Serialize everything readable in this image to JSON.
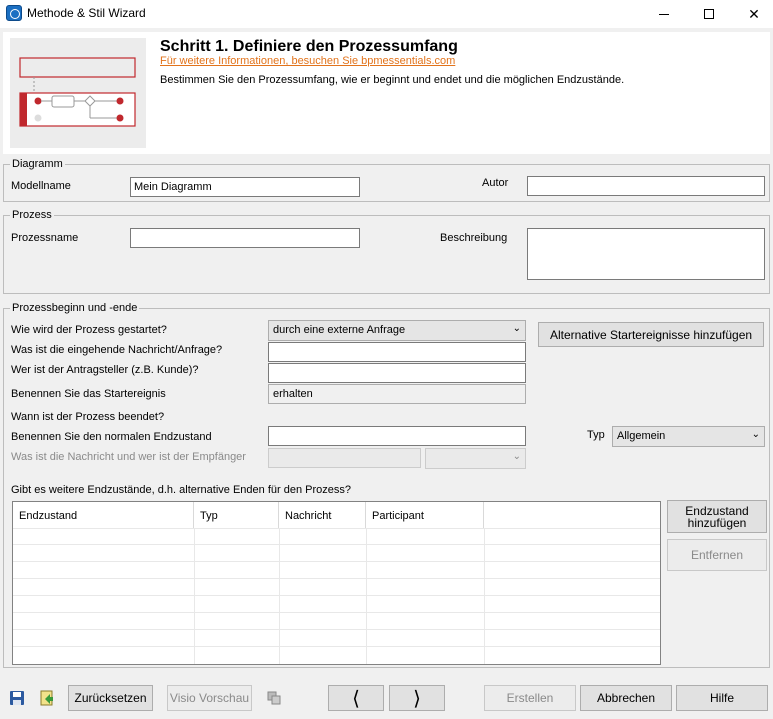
{
  "window": {
    "title": "Methode & Stil Wizard"
  },
  "header": {
    "step_title": "Schritt 1. Definiere den Prozessumfang",
    "link": "Für weitere Informationen, besuchen Sie bpmessentials.com",
    "description": "Bestimmen Sie den Prozessumfang, wie er beginnt und endet und die möglichen Endzustände."
  },
  "diagram": {
    "legend": "Diagramm",
    "model_name_label": "Modellname",
    "model_name_value": "Mein Diagramm",
    "author_label": "Autor",
    "author_value": ""
  },
  "process": {
    "legend": "Prozess",
    "name_label": "Prozessname",
    "name_value": "",
    "description_label": "Beschreibung",
    "description_value": ""
  },
  "start_end": {
    "legend": "Prozessbeginn und -ende",
    "how_started_label": "Wie wird der Prozess gestartet?",
    "how_started_value": "durch eine externe Anfrage",
    "alt_start_button": "Alternative Startereignisse hinzufügen",
    "incoming_message_label": "Was ist die eingehende Nachricht/Anfrage?",
    "incoming_message_value": "",
    "requester_label": "Wer ist der Antragsteller (z.B. Kunde)?",
    "requester_value": "",
    "start_event_label": "Benennen Sie das Startereignis",
    "start_event_value": "erhalten",
    "when_ended_label": "Wann ist der Prozess beendet?",
    "normal_end_label": "Benennen Sie den normalen Endzustand",
    "normal_end_value": "",
    "type_label": "Typ",
    "type_value": "Allgemein",
    "message_receiver_label": "Was ist die Nachricht und wer ist der Empfänger",
    "further_end_label": "Gibt es weitere Endzustände, d.h. alternative Enden für den Prozess?",
    "add_end_button": "Endzustand hinzufügen",
    "remove_button": "Entfernen",
    "table": {
      "columns": [
        "Endzustand",
        "Typ",
        "Nachricht",
        "Participant"
      ],
      "rows": []
    }
  },
  "footer": {
    "reset_button": "Zurücksetzen",
    "visio_preview_button": "Visio Vorschau",
    "back_icon": "chevron-left",
    "next_icon": "chevron-right",
    "create_button": "Erstellen",
    "cancel_button": "Abbrechen",
    "help_button": "Hilfe"
  },
  "colors": {
    "accent_red": "#c0282d",
    "link_orange": "#e2731b"
  }
}
